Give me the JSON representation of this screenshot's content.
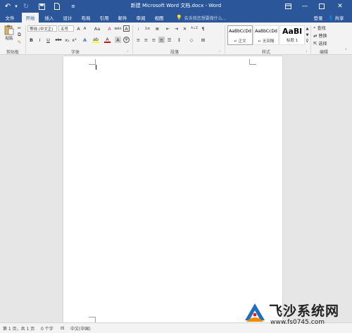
{
  "title_bar": {
    "title": "新建 Microsoft Word 文档.docx - Word",
    "quick_access": [
      "undo-icon",
      "redo-icon",
      "save-icon",
      "new-doc-icon",
      "customize-icon"
    ],
    "window_buttons": [
      "ribbon-display-icon",
      "minimize-icon",
      "maximize-icon",
      "close-icon"
    ]
  },
  "tabs": {
    "items": [
      "文件",
      "开始",
      "插入",
      "设计",
      "布局",
      "引用",
      "邮件",
      "审阅",
      "视图"
    ],
    "active": "开始",
    "tell_me": "告诉我您想要做什么...",
    "sign_in": "登录",
    "share": "共享"
  },
  "ribbon": {
    "clipboard": {
      "label": "剪贴板",
      "paste": "粘贴"
    },
    "font": {
      "label": "字体",
      "font_name": "等线 (中文正)",
      "font_size": "五号",
      "grow": "A",
      "shrink": "A",
      "case": "Aa",
      "clear": "A",
      "bold": "B",
      "italic": "I",
      "underline": "U",
      "strike": "abc",
      "subscript": "x₂",
      "superscript": "x²",
      "effects": "A",
      "highlight": "ab",
      "color": "A",
      "border": "A",
      "phonetic": "wén",
      "enclose": "字"
    },
    "paragraph": {
      "label": "段落",
      "sort": "A↓Z",
      "marks": "¶"
    },
    "styles": {
      "label": "样式",
      "items": [
        {
          "sample": "AaBbCcDd",
          "name": "↵ 正文"
        },
        {
          "sample": "AaBbCcDd",
          "name": "↵ 无间隔"
        },
        {
          "sample": "AaBl",
          "name": "标题 1"
        }
      ]
    },
    "editing": {
      "label": "编辑",
      "find": "查找",
      "replace": "替换",
      "select": "选择"
    }
  },
  "status_bar": {
    "page": "第 1 页，共 1 页",
    "words": "0 个字",
    "language": "中文(中国)"
  },
  "watermark": {
    "title": "飞沙系统网",
    "url": "www.fs0745.com"
  },
  "colors": {
    "accent": "#2b579a",
    "ribbon_bg": "#f3f3f3",
    "workspace": "#e6e6e6",
    "highlight_yellow": "#ffff00",
    "font_red": "#e00000"
  }
}
